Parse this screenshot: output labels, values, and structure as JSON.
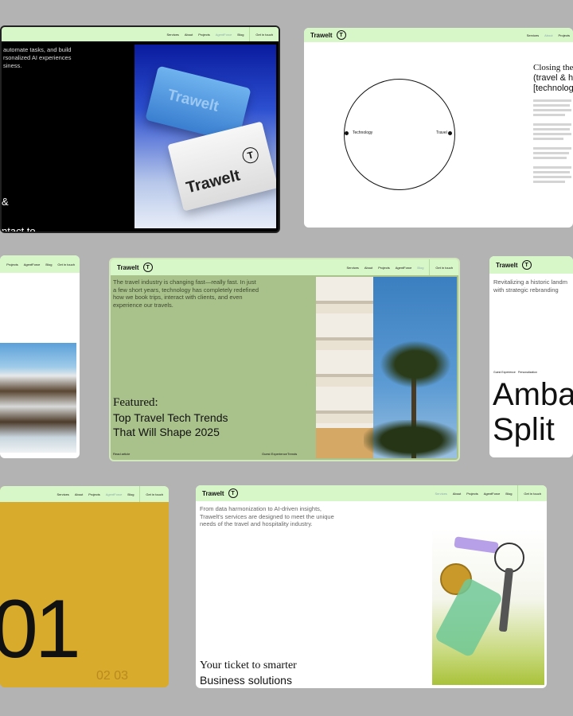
{
  "brand": "Trawelt",
  "logo_glyph": "T",
  "nav_links": [
    "Services",
    "About",
    "Projects",
    "AgentForce",
    "Blog"
  ],
  "nav_cta": "Get in touch",
  "card1": {
    "intro": "automate tasks, and build\nrsonalized AI experiences\nsiness.",
    "ampersand": "&",
    "contact": "ntact to",
    "box_top_text": "Trawelt",
    "box_bottom_text": "Trawelt"
  },
  "card2": {
    "heading_line1": "Closing the",
    "heading_line2": "(travel & ho",
    "heading_line3": "[technology",
    "label_left": "Technology",
    "label_right": "Travel"
  },
  "card3": {},
  "card4": {
    "intro": "The travel industry is changing fast—really fast. In just a few short years, technology has completely redefined how we book trips, interact with clients, and even experience our travels.",
    "featured_label": "Featured:",
    "title_line1": "Top Travel Tech Trends",
    "title_line2": "That Will Shape 2025",
    "footer_left": "Read article",
    "footer_tags": [
      "Guest Experience",
      "Trends"
    ]
  },
  "card5": {
    "intro": "Revitalizing a historic landm\nwith strategic rebranding",
    "tags": [
      "Guest Experience",
      "Personalization"
    ],
    "title_line1": "Amba",
    "title_line2": "Split"
  },
  "card6": {
    "big_number": "01",
    "pager": "02 03"
  },
  "card7": {
    "intro": "From data harmonization to AI-driven insights, Trawelt's services are designed to meet the unique needs of the travel and hospitality industry.",
    "tagline_line1": "Your ticket to smarter",
    "tagline_line2": "Business solutions"
  },
  "colors": {
    "background": "#b3b3b3",
    "nav": "#d8f7c8",
    "sage": "#a9c18a",
    "mustard": "#d9ab2c",
    "blue_box": "#4a8fd6"
  }
}
